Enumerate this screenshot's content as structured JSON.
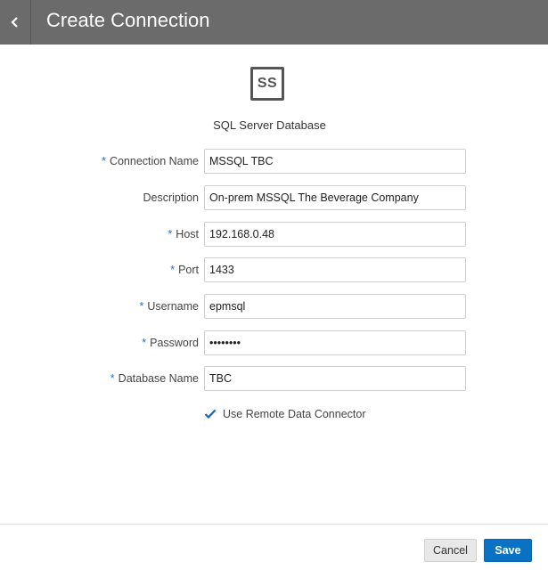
{
  "header": {
    "title": "Create Connection"
  },
  "connection_type": {
    "icon_text": "SS",
    "label": "SQL Server Database"
  },
  "form": {
    "required_marker": "*",
    "fields": [
      {
        "label": "Connection Name",
        "value": "MSSQL TBC",
        "required": true
      },
      {
        "label": "Description",
        "value": "On-prem MSSQL The Beverage Company",
        "required": false
      },
      {
        "label": "Host",
        "value": "192.168.0.48",
        "required": true
      },
      {
        "label": "Port",
        "value": "1433",
        "required": true
      },
      {
        "label": "Username",
        "value": "epmsql",
        "required": true
      },
      {
        "label": "Password",
        "value": "••••••••",
        "required": true
      },
      {
        "label": "Database Name",
        "value": "TBC",
        "required": true
      }
    ],
    "remote_connector": {
      "label": "Use Remote Data Connector",
      "checked": true
    }
  },
  "footer": {
    "cancel_label": "Cancel",
    "save_label": "Save"
  },
  "colors": {
    "header_bg": "#6b6b6b",
    "accent": "#0a72c4",
    "required_marker": "#1a73c7"
  }
}
